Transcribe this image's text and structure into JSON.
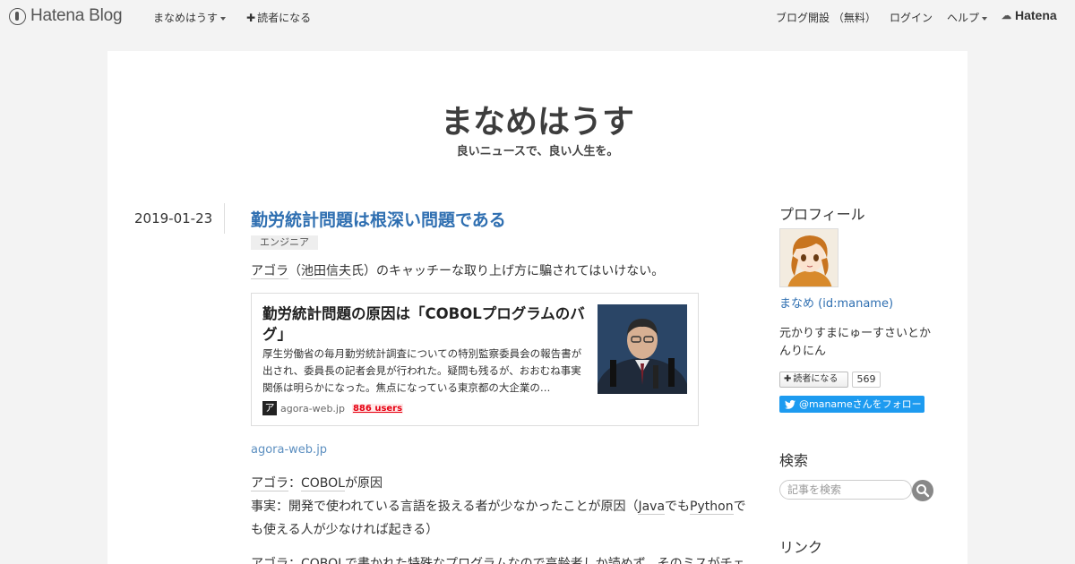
{
  "globalbar": {
    "logo_text": "Hatena Blog",
    "blog_menu": "まなめはうす",
    "subscribe": "読者になる",
    "open_blog": "ブログ開設 （無料）",
    "login": "ログイン",
    "help": "ヘルプ",
    "brand": "Hatena"
  },
  "header": {
    "title": "まなめはうす",
    "description": "良いニュースで、良い人生を。"
  },
  "entry": {
    "date": "2019-01-23",
    "title": "勤労統計問題は根深い問題である",
    "category": "エンジニア",
    "intro": {
      "k1": "アゴラ",
      "p1": "（",
      "k2": "池田信夫",
      "p2": "氏）のキャッチーな取り上げ方に騙されてはいけない。"
    },
    "embed": {
      "title": "勤労統計問題の原因は「COBOLプログラムのバグ」",
      "description": "厚生労働省の毎月勤労統計調査についての特別監察委員会の報告書が出され、委員長の記者会見が行われた。疑問も残るが、おおむね事実関係は明らかになった。焦点になっている東京都の大企業の…",
      "favicon": "ア",
      "source": "agora-web.jp",
      "users": "886 users"
    },
    "link_domain": "agora-web.jp",
    "para1": {
      "k1": "アゴラ",
      "p1": "：",
      "k2": "COBOL",
      "p2": "が原因"
    },
    "para2": {
      "p1": "事実：開発で使われている言語を扱える者が少なかったことが原因（",
      "k1": "Java",
      "p2": "でも",
      "k2": "Python",
      "p3": "でも使える人が少なければ起きる）"
    },
    "para3": {
      "k1": "アゴラ",
      "p1": "：",
      "k2": "COBOL",
      "p2": "で書かれた特殊なプログラムなので高齢者しか読めず、そのミスがチェ"
    }
  },
  "sidebar": {
    "profile_heading": "プロフィール",
    "profile_name": "まなめ (id:maname)",
    "profile_bio": "元かりすまにゅーすさいとかんりにん",
    "subscribe_label": "読者になる",
    "subscriber_count": "569",
    "twitter_follow": "@manameさんをフォロー",
    "search_heading": "検索",
    "search_placeholder": "記事を検索",
    "links_heading": "リンク"
  }
}
